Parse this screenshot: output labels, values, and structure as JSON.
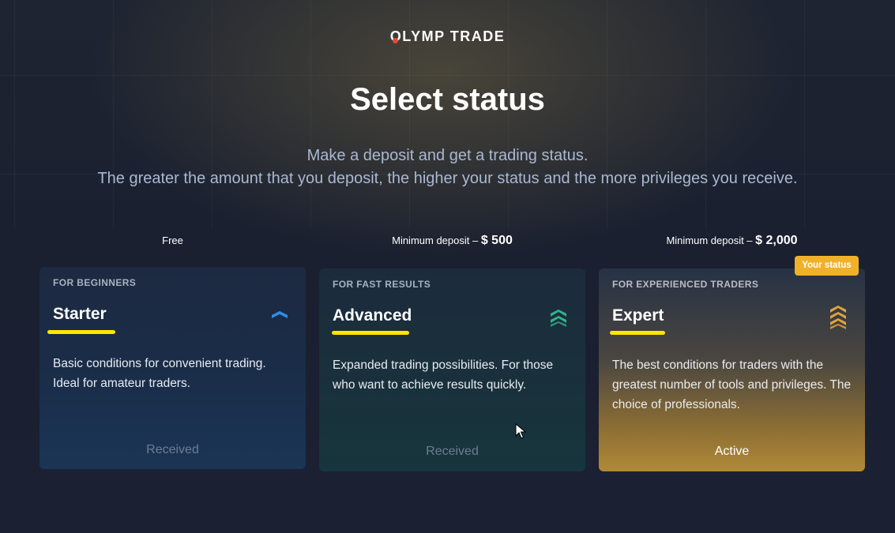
{
  "brand": {
    "logo_o": "O",
    "logo_rest": "LYMP TRADE"
  },
  "page": {
    "title": "Select status",
    "subtitle_line1": "Make a deposit and get a trading status.",
    "subtitle_line2": "The greater the amount that you deposit, the higher your status and the more privileges you receive."
  },
  "tiers": [
    {
      "deposit_label": "Free",
      "deposit_amount": "",
      "category": "FOR BEGINNERS",
      "name": "Starter",
      "description": "Basic conditions for convenient trading. Ideal for amateur traders.",
      "footer": "Received",
      "icon": "starter-chevron-icon",
      "icon_color": "#2f8ee6"
    },
    {
      "deposit_label": "Minimum deposit – ",
      "deposit_amount": "$ 500",
      "category": "FOR FAST RESULTS",
      "name": "Advanced",
      "description": "Expanded trading possibilities. For those who want to achieve results quickly.",
      "footer": "Received",
      "icon": "advanced-chevron-icon",
      "icon_color": "#2fb38a"
    },
    {
      "deposit_label": "Minimum deposit – ",
      "deposit_amount": "$ 2,000",
      "category": "FOR EXPERIENCED TRADERS",
      "name": "Expert",
      "description": "The best conditions for traders with the greatest number of tools and privileges. The choice of professionals.",
      "footer": "Active",
      "icon": "expert-chevron-icon",
      "icon_color": "#e0a33a",
      "badge": "Your status"
    }
  ],
  "colors": {
    "accent_yellow": "#ffe600",
    "badge": "#f0b12a",
    "logo_dot": "#e24b3c"
  }
}
